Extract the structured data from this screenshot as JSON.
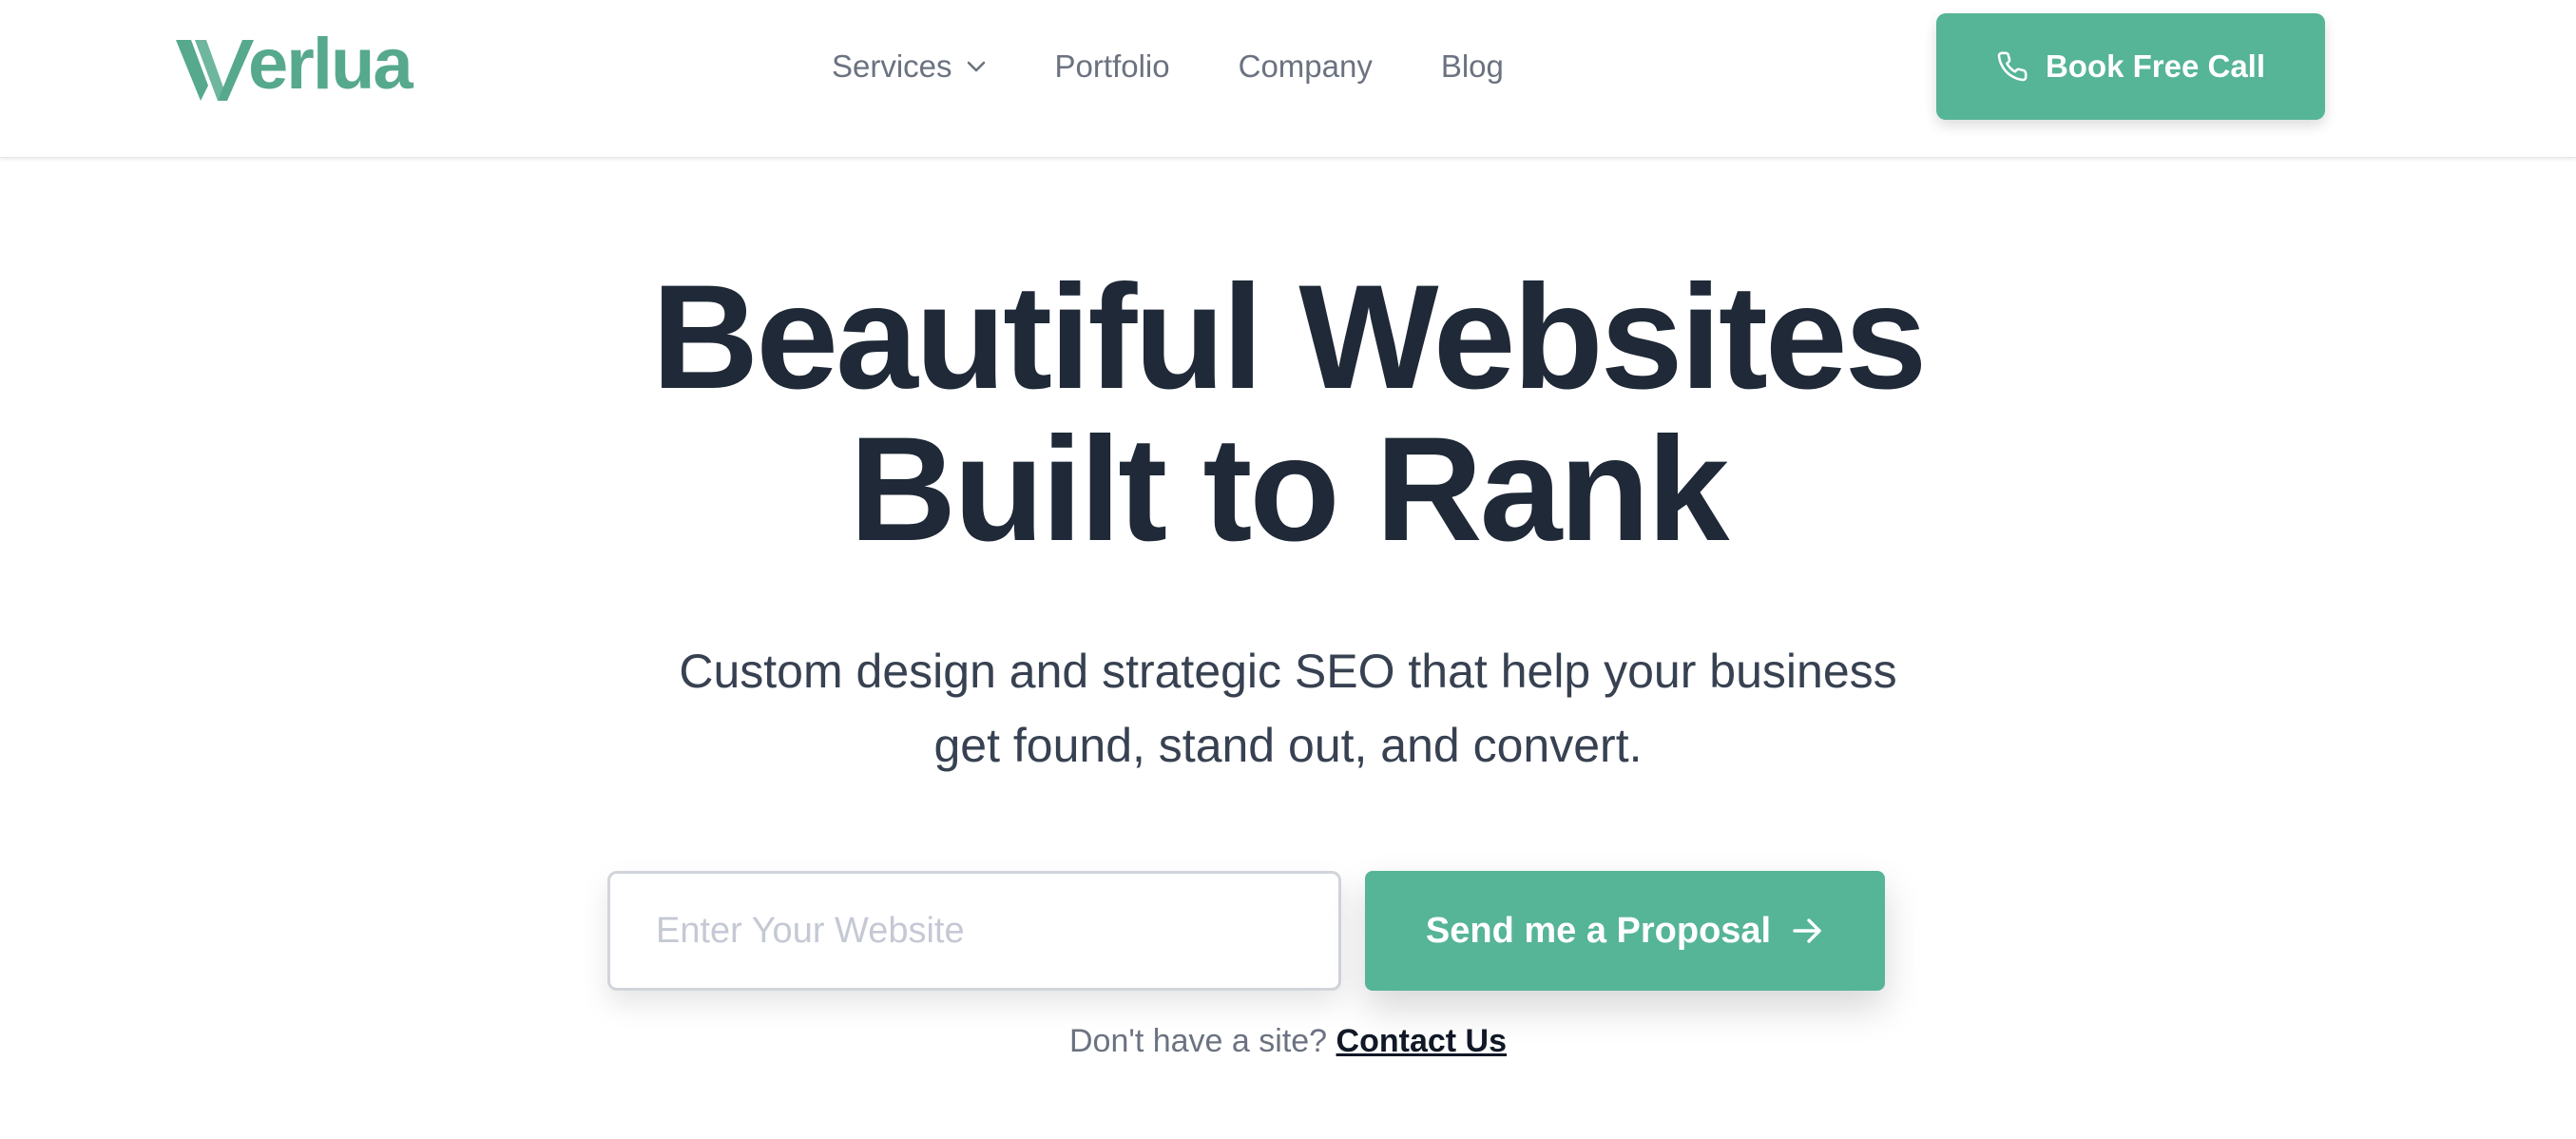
{
  "brand": {
    "name": "Verlua",
    "color": "#56a98d"
  },
  "nav": {
    "items": [
      {
        "label": "Services",
        "has_dropdown": true,
        "icon": "chevron-down-icon"
      },
      {
        "label": "Portfolio"
      },
      {
        "label": "Company"
      },
      {
        "label": "Blog"
      }
    ]
  },
  "header_cta": {
    "label": "Book Free Call",
    "icon": "phone-icon",
    "color": "#56b497"
  },
  "hero": {
    "title_line1": "Beautiful Websites",
    "title_line2": "Built to Rank",
    "subtitle_line1": "Custom design and strategic SEO that help your business",
    "subtitle_line2": "get found, stand out, and convert."
  },
  "form": {
    "input_placeholder": "Enter Your Website",
    "input_value": "",
    "submit_label": "Send me a Proposal",
    "submit_icon": "arrow-right-icon"
  },
  "contact": {
    "prompt": "Don't have a site? ",
    "link_label": "Contact Us"
  },
  "colors": {
    "accent": "#56b497",
    "heading": "#1f2937",
    "muted": "#6b7280"
  }
}
